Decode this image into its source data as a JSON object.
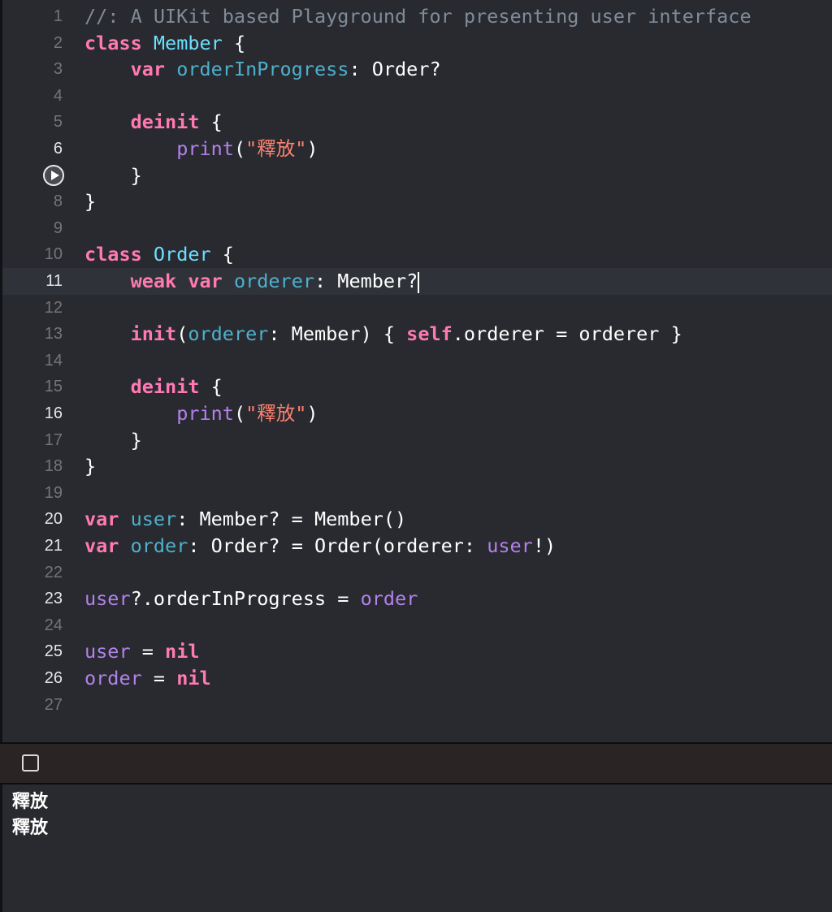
{
  "editor": {
    "lines": [
      {
        "number": "1",
        "tokens": [
          {
            "t": "//: A UIKit based Playground for presenting user interface",
            "c": "comment"
          }
        ]
      },
      {
        "number": "2",
        "tokens": [
          {
            "t": "class",
            "c": "keyword"
          },
          {
            "t": " ",
            "c": "plain"
          },
          {
            "t": "Member",
            "c": "typedecl"
          },
          {
            "t": " {",
            "c": "plain"
          }
        ]
      },
      {
        "number": "3",
        "tokens": [
          {
            "t": "    ",
            "c": "plain"
          },
          {
            "t": "var",
            "c": "keyword"
          },
          {
            "t": " ",
            "c": "plain"
          },
          {
            "t": "orderInProgress",
            "c": "property"
          },
          {
            "t": ": Order?",
            "c": "plain"
          }
        ]
      },
      {
        "number": "4",
        "tokens": []
      },
      {
        "number": "5",
        "tokens": [
          {
            "t": "    ",
            "c": "plain"
          },
          {
            "t": "deinit",
            "c": "keyword"
          },
          {
            "t": " {",
            "c": "plain"
          }
        ]
      },
      {
        "number": "6",
        "tokens": [
          {
            "t": "        ",
            "c": "plain"
          },
          {
            "t": "print",
            "c": "other"
          },
          {
            "t": "(",
            "c": "plain"
          },
          {
            "t": "\"釋放\"",
            "c": "string"
          },
          {
            "t": ")",
            "c": "plain"
          }
        ]
      },
      {
        "number": "7",
        "tokens": [
          {
            "t": "    }",
            "c": "plain"
          }
        ]
      },
      {
        "number": "8",
        "tokens": [
          {
            "t": "}",
            "c": "plain"
          }
        ]
      },
      {
        "number": "9",
        "tokens": []
      },
      {
        "number": "10",
        "tokens": [
          {
            "t": "class",
            "c": "keyword"
          },
          {
            "t": " ",
            "c": "plain"
          },
          {
            "t": "Order",
            "c": "typedecl"
          },
          {
            "t": " {",
            "c": "plain"
          }
        ]
      },
      {
        "number": "11",
        "tokens": [
          {
            "t": "    ",
            "c": "plain"
          },
          {
            "t": "weak",
            "c": "keyword"
          },
          {
            "t": " ",
            "c": "plain"
          },
          {
            "t": "var",
            "c": "keyword"
          },
          {
            "t": " ",
            "c": "plain"
          },
          {
            "t": "orderer",
            "c": "property"
          },
          {
            "t": ": Member?",
            "c": "plain"
          }
        ]
      },
      {
        "number": "12",
        "tokens": []
      },
      {
        "number": "13",
        "tokens": [
          {
            "t": "    ",
            "c": "plain"
          },
          {
            "t": "init",
            "c": "keyword"
          },
          {
            "t": "(",
            "c": "plain"
          },
          {
            "t": "orderer",
            "c": "property"
          },
          {
            "t": ": Member) { ",
            "c": "plain"
          },
          {
            "t": "self",
            "c": "keyword"
          },
          {
            "t": ".orderer = orderer }",
            "c": "plain"
          }
        ]
      },
      {
        "number": "14",
        "tokens": []
      },
      {
        "number": "15",
        "tokens": [
          {
            "t": "    ",
            "c": "plain"
          },
          {
            "t": "deinit",
            "c": "keyword"
          },
          {
            "t": " {",
            "c": "plain"
          }
        ]
      },
      {
        "number": "16",
        "tokens": [
          {
            "t": "        ",
            "c": "plain"
          },
          {
            "t": "print",
            "c": "other"
          },
          {
            "t": "(",
            "c": "plain"
          },
          {
            "t": "\"釋放\"",
            "c": "string"
          },
          {
            "t": ")",
            "c": "plain"
          }
        ]
      },
      {
        "number": "17",
        "tokens": [
          {
            "t": "    }",
            "c": "plain"
          }
        ]
      },
      {
        "number": "18",
        "tokens": [
          {
            "t": "}",
            "c": "plain"
          }
        ]
      },
      {
        "number": "19",
        "tokens": []
      },
      {
        "number": "20",
        "tokens": [
          {
            "t": "var",
            "c": "keyword"
          },
          {
            "t": " ",
            "c": "plain"
          },
          {
            "t": "user",
            "c": "property"
          },
          {
            "t": ": Member? = Member()",
            "c": "plain"
          }
        ]
      },
      {
        "number": "21",
        "tokens": [
          {
            "t": "var",
            "c": "keyword"
          },
          {
            "t": " ",
            "c": "plain"
          },
          {
            "t": "order",
            "c": "property"
          },
          {
            "t": ": Order? = Order(orderer: ",
            "c": "plain"
          },
          {
            "t": "user",
            "c": "other"
          },
          {
            "t": "!)",
            "c": "plain"
          }
        ]
      },
      {
        "number": "22",
        "tokens": []
      },
      {
        "number": "23",
        "tokens": [
          {
            "t": "user",
            "c": "other"
          },
          {
            "t": "?.orderInProgress = ",
            "c": "plain"
          },
          {
            "t": "order",
            "c": "other"
          }
        ]
      },
      {
        "number": "24",
        "tokens": []
      },
      {
        "number": "25",
        "tokens": [
          {
            "t": "user",
            "c": "other"
          },
          {
            "t": " = ",
            "c": "plain"
          },
          {
            "t": "nil",
            "c": "keyword"
          }
        ]
      },
      {
        "number": "26",
        "tokens": [
          {
            "t": "order",
            "c": "other"
          },
          {
            "t": " = ",
            "c": "plain"
          },
          {
            "t": "nil",
            "c": "keyword"
          }
        ]
      },
      {
        "number": "27",
        "tokens": []
      }
    ],
    "bright_line_numbers": [
      "6",
      "11",
      "16",
      "20",
      "21",
      "23",
      "25",
      "26"
    ],
    "current_line": "11",
    "run_button_line": "7",
    "colors": {
      "background": "#292a30",
      "comment": "#7f8c98",
      "keyword": "#ff7ab2",
      "type_declaration": "#6bdfff",
      "property": "#4eb0cc",
      "other_declaration": "#b281eb",
      "string": "#ff8170",
      "plain": "#ffffff"
    }
  },
  "debug_bar": {
    "toggle_icon": "checkbox-square-icon"
  },
  "console": {
    "output": [
      "釋放",
      "釋放"
    ]
  }
}
